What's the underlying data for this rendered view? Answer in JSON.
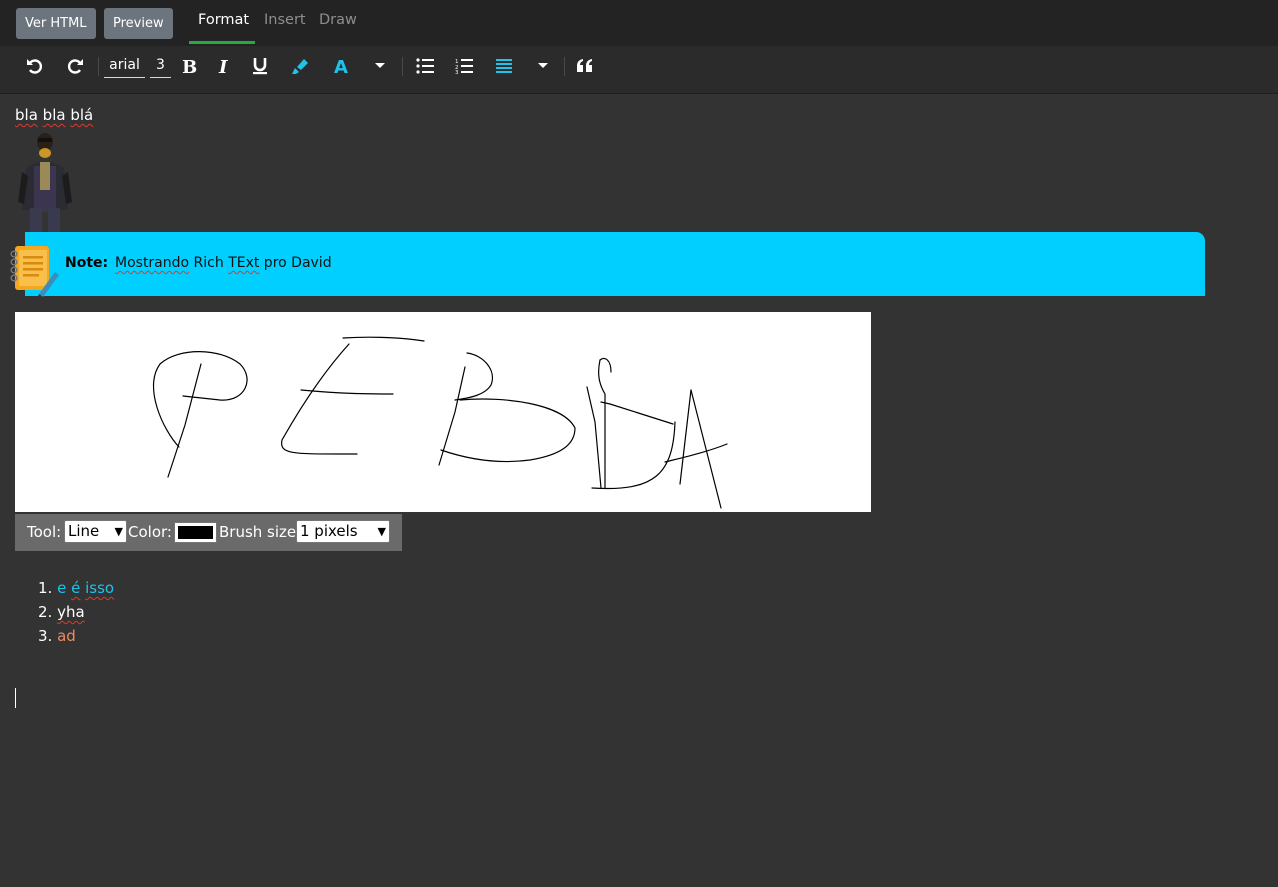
{
  "topbar": {
    "view_html_label": "Ver HTML",
    "preview_label": "Preview",
    "tabs": [
      {
        "label": "Format",
        "active": true
      },
      {
        "label": "Insert",
        "active": false
      },
      {
        "label": "Draw",
        "active": false
      }
    ],
    "active_tab_color": "#28a745"
  },
  "toolbar": {
    "font_family": "arial",
    "font_size": "3",
    "icons": [
      "undo-icon",
      "redo-icon",
      "bold-icon",
      "italic-icon",
      "underline-icon",
      "highlighter-icon",
      "font-color-icon",
      "dropdown-icon",
      "bullet-list-icon",
      "numbered-list-icon",
      "align-icon",
      "dropdown-icon",
      "quote-icon"
    ],
    "accent_color": "#1fc2ea"
  },
  "content": {
    "line1_words": [
      "bla",
      "bla",
      "blá"
    ],
    "note": {
      "label": "Note:",
      "words": [
        {
          "t": "Mostrando",
          "sq": true
        },
        {
          "t": " Rich ",
          "sq": false
        },
        {
          "t": "TExt",
          "sq": true
        },
        {
          "t": " pro David",
          "sq": false
        }
      ],
      "background": "#00cfff"
    },
    "drawing_controls": {
      "tool_label": "Tool:",
      "tool_value": "Line",
      "color_label": "Color:",
      "color_value": "#000000",
      "brush_label": "Brush size:",
      "brush_value": "1 pixels"
    },
    "ordered_list": [
      {
        "num": "1.",
        "words": [
          {
            "t": "e",
            "sq": false
          },
          {
            "t": " ",
            "sq": false
          },
          {
            "t": "é",
            "sq": true
          },
          {
            "t": " ",
            "sq": false
          },
          {
            "t": "isso",
            "sq": true
          }
        ],
        "color": "#1fc2ea"
      },
      {
        "num": "2.",
        "words": [
          {
            "t": "yha",
            "sq": true
          }
        ],
        "color": "#ffffff"
      },
      {
        "num": "3.",
        "words": [
          {
            "t": "ad",
            "sq": false
          }
        ],
        "color": "#f08a5d"
      }
    ]
  }
}
